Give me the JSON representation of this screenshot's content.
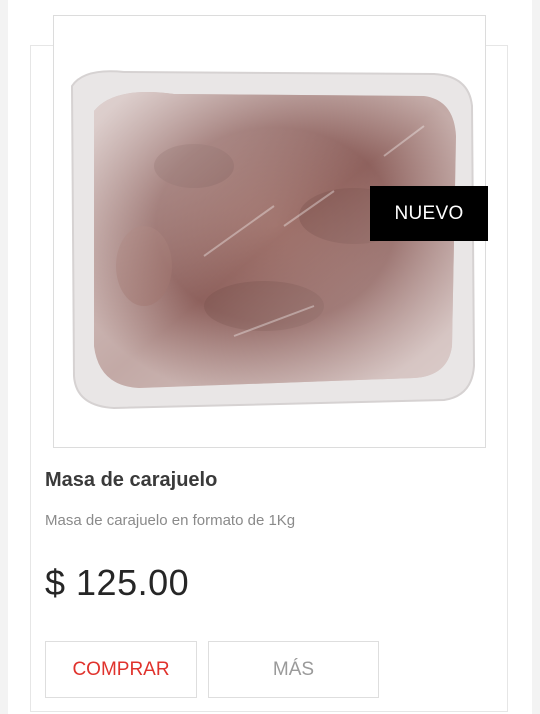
{
  "product": {
    "badge": "NUEVO",
    "title": "Masa de carajuelo",
    "description": "Masa de carajuelo en formato de 1Kg",
    "price": "$ 125.00"
  },
  "actions": {
    "buy_label": "COMPRAR",
    "more_label": "MÁS"
  },
  "colors": {
    "buy_text": "#e0322c",
    "badge_background": "#000000"
  }
}
